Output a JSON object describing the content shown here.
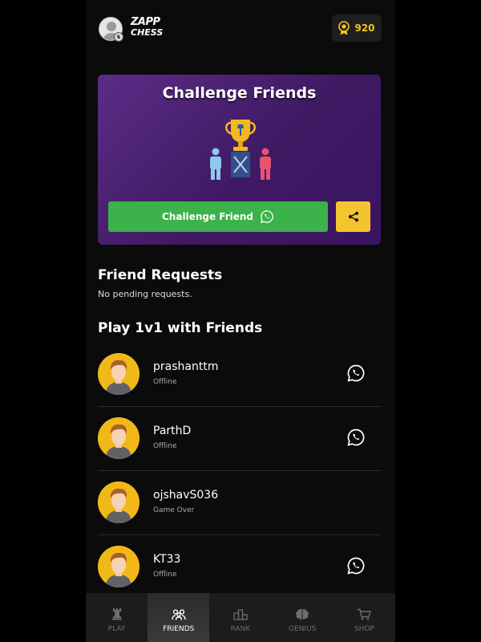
{
  "header": {
    "logo_line1": "ZAPP",
    "logo_line2": "CHESS",
    "coins": "920"
  },
  "challenge_card": {
    "title": "Challenge Friends",
    "button_label": "Challenge Friend"
  },
  "friend_requests": {
    "heading": "Friend Requests",
    "empty_text": "No pending requests."
  },
  "play_section": {
    "heading": "Play 1v1 with Friends"
  },
  "friends": [
    {
      "name": "prashanttm",
      "status": "Offline",
      "whatsapp": true
    },
    {
      "name": "ParthD",
      "status": "Offline",
      "whatsapp": true
    },
    {
      "name": "ojshavS036",
      "status": "Game Over",
      "whatsapp": false
    },
    {
      "name": "KT33",
      "status": "Offline",
      "whatsapp": true
    }
  ],
  "bottom_nav": [
    {
      "label": "PLAY",
      "icon": "rook-icon",
      "active": false
    },
    {
      "label": "FRIENDS",
      "icon": "friends-icon",
      "active": true
    },
    {
      "label": "RANK",
      "icon": "podium-icon",
      "active": false
    },
    {
      "label": "GENIUS",
      "icon": "brain-icon",
      "active": false
    },
    {
      "label": "SHOP",
      "icon": "cart-icon",
      "active": false
    }
  ],
  "colors": {
    "accent_green": "#3bb24a",
    "accent_yellow": "#f4c430",
    "coin_gold": "#f5c518",
    "card_purple": "#4a1f72"
  }
}
